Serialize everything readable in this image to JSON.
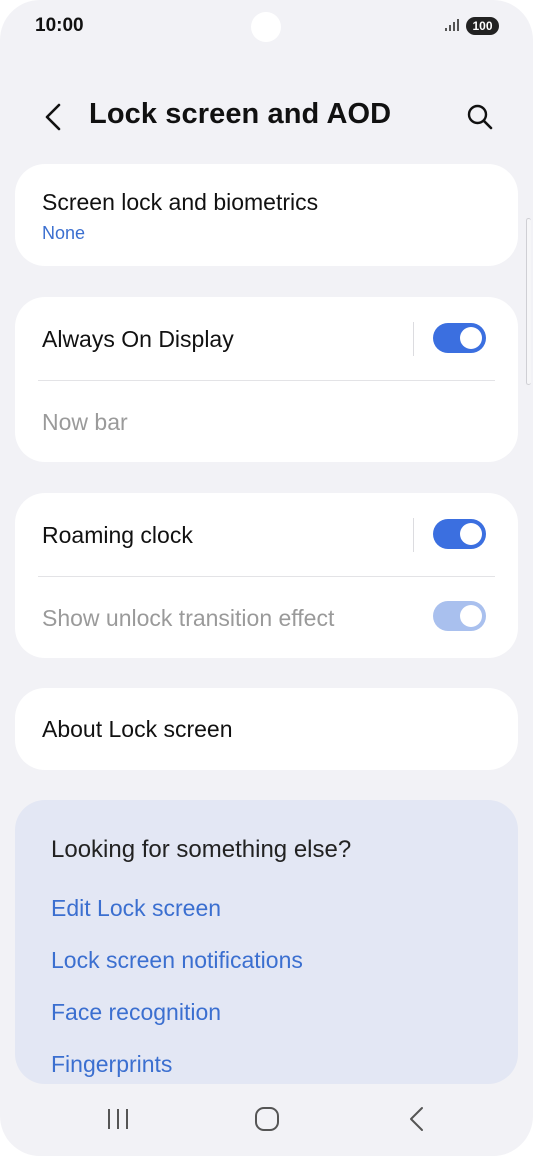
{
  "status": {
    "time": "10:00",
    "battery": "100"
  },
  "header": {
    "title": "Lock screen and AOD"
  },
  "cards": {
    "screen_lock": {
      "title": "Screen lock and biometrics",
      "value": "None"
    },
    "aod": {
      "title": "Always On Display",
      "toggle_on": true,
      "now_bar": "Now bar"
    },
    "roaming": {
      "title": "Roaming clock",
      "toggle_on": true,
      "unlock_effect": "Show unlock transition effect",
      "unlock_toggle_on": true
    },
    "about": {
      "title": "About Lock screen"
    }
  },
  "suggestions": {
    "title": "Looking for something else?",
    "links": [
      "Edit Lock screen",
      "Lock screen notifications",
      "Face recognition",
      "Fingerprints"
    ]
  },
  "colors": {
    "accent": "#3b6fe0",
    "link": "#3b6fd0",
    "background": "#f2f2f6",
    "suggest_bg": "#e3e7f4"
  },
  "icons": {
    "back": "chevron-left-icon",
    "search": "search-icon",
    "recents": "recents-icon",
    "home": "home-icon",
    "nav_back": "nav-back-icon"
  }
}
